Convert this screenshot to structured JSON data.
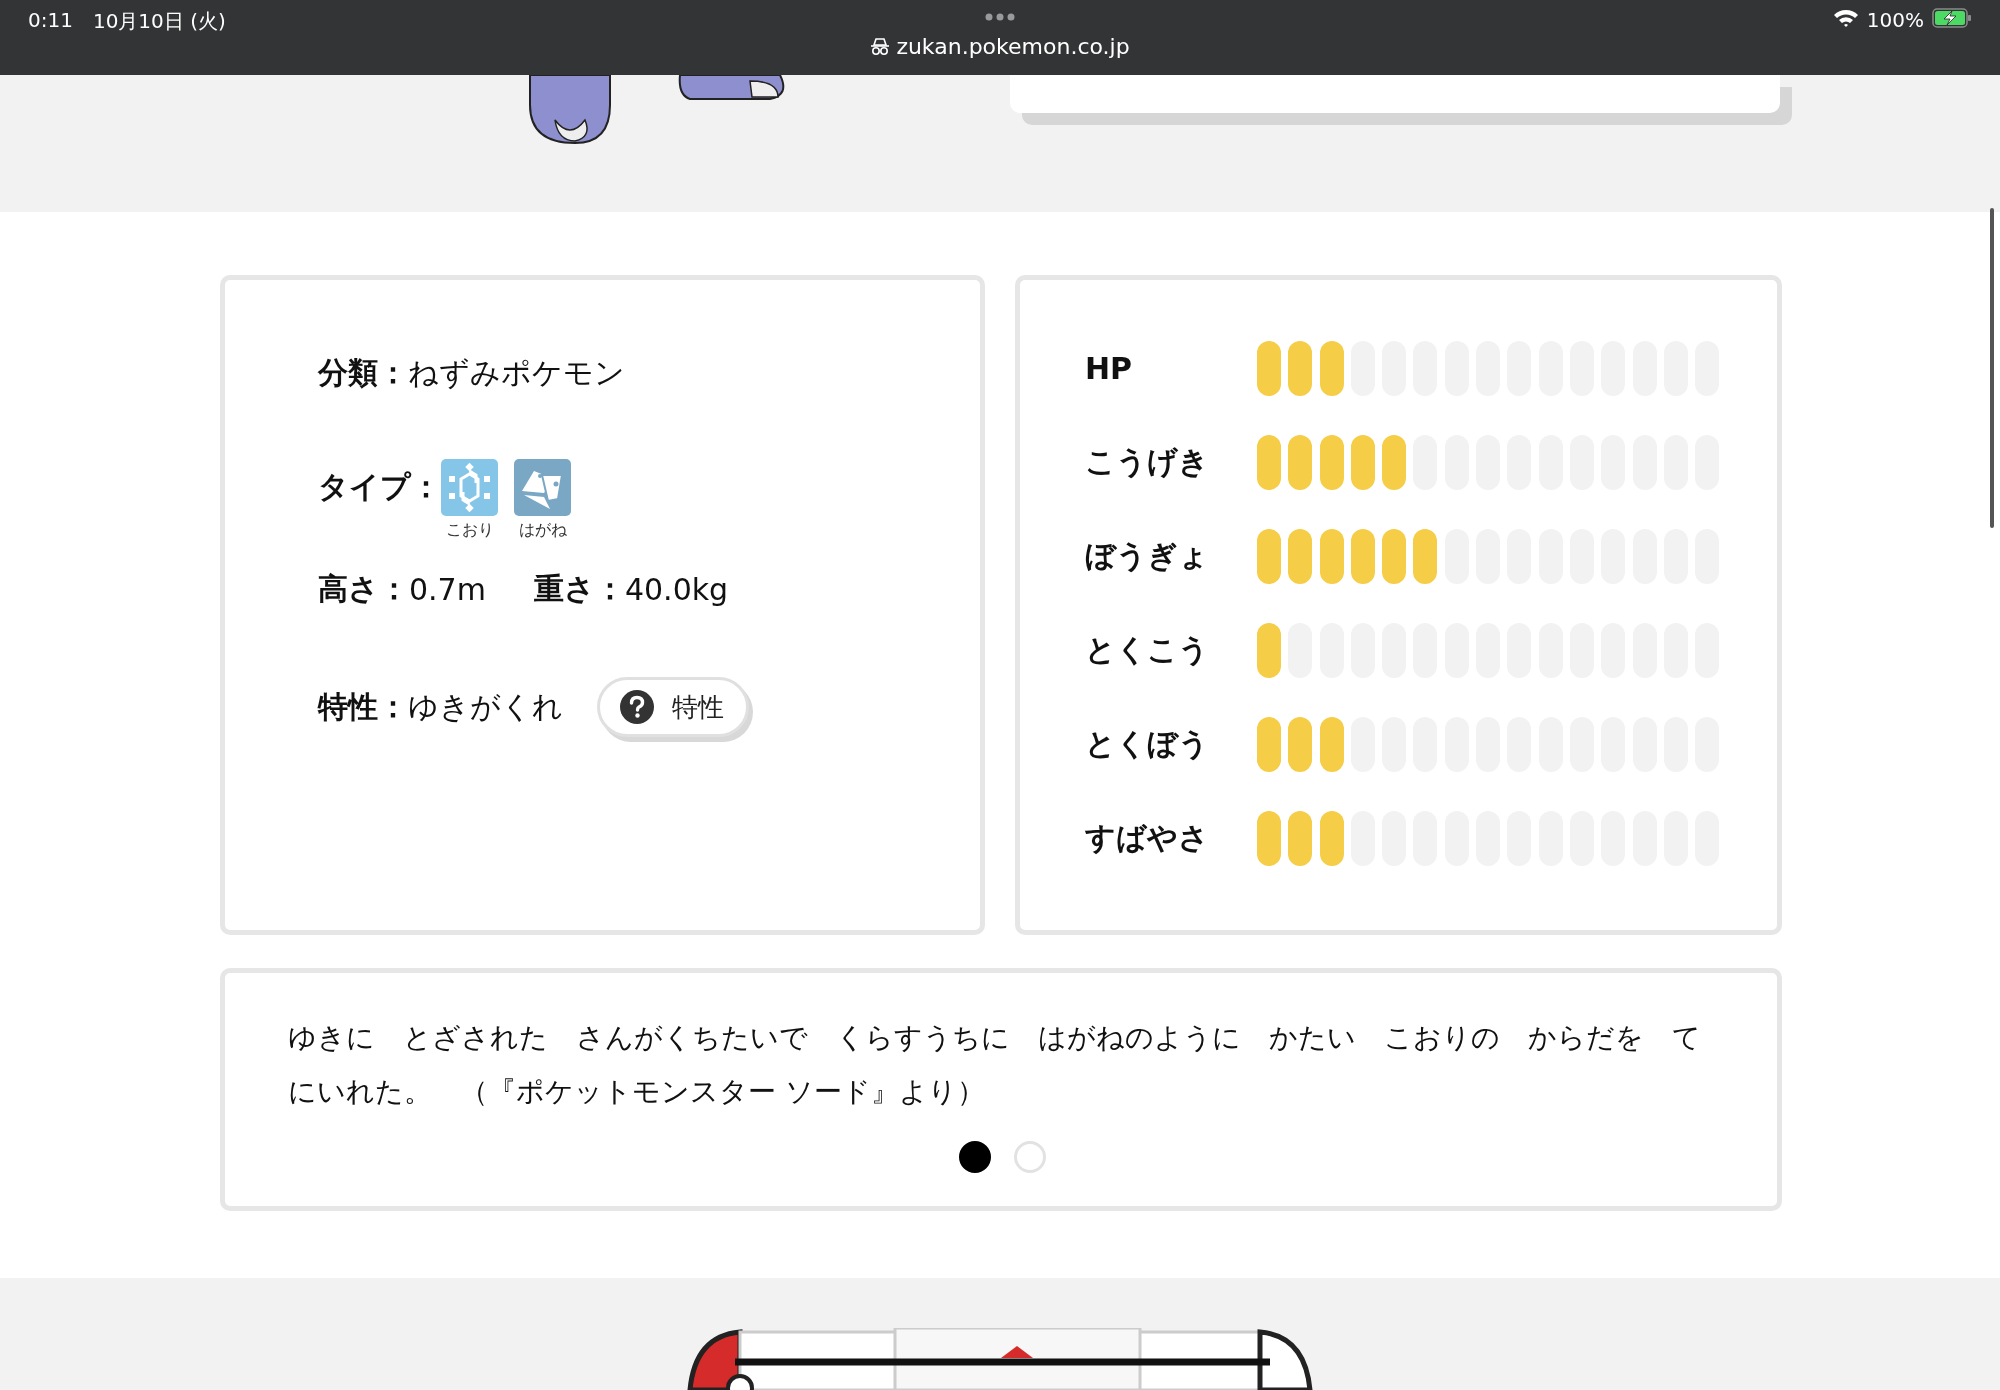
{
  "status_bar": {
    "time": "0:11",
    "date": "10月10日 (火)",
    "url": "zukan.pokemon.co.jp",
    "battery": "100%"
  },
  "profile": {
    "category_label": "分類：",
    "category": "ねずみポケモン",
    "type_label": "タイプ：",
    "types": [
      {
        "kind": "ice",
        "name": "こおり",
        "color": "#85c6e8"
      },
      {
        "kind": "steel",
        "name": "はがね",
        "color": "#7aa7c4"
      }
    ],
    "height_label": "高さ：",
    "height": "0.7m",
    "weight_label": "重さ：",
    "weight": "40.0kg",
    "ability_label": "特性：",
    "ability": "ゆきがくれ",
    "ability_button": "特性"
  },
  "stats": [
    {
      "name": "HP",
      "level": 0.2
    },
    {
      "name": "こうげき",
      "level": 0.3333
    },
    {
      "name": "ぼうぎょ",
      "level": 0.4
    },
    {
      "name": "とくこう",
      "level": 0.0667
    },
    {
      "name": "とくぼう",
      "level": 0.2
    },
    {
      "name": "すばやさ",
      "level": 0.2
    }
  ],
  "description": {
    "text": "ゆきに　とざされた　さんがくちたいで　くらすうちに　はがねのように　かたい　こおりの　からだを　てにいれた。　（『ポケットモンスター ソード』より）",
    "pages": [
      {
        "selected": true
      },
      {
        "selected": false
      }
    ]
  }
}
